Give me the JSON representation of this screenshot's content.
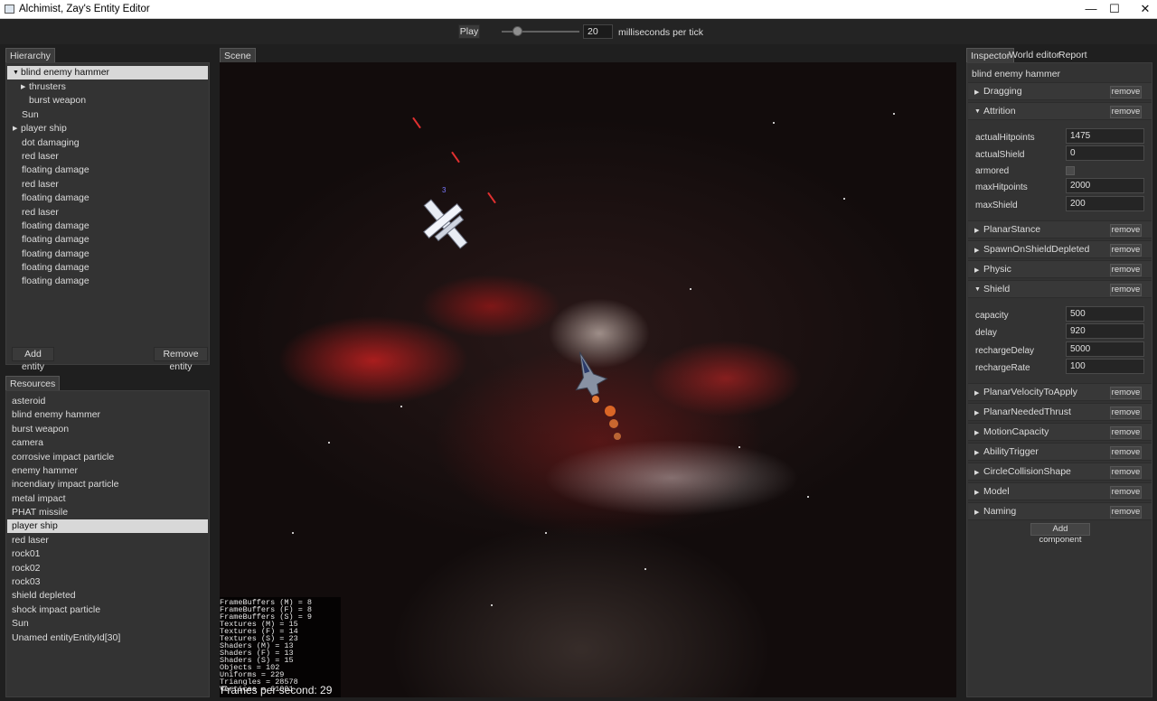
{
  "window": {
    "title": "Alchimist, Zay's Entity Editor"
  },
  "toolbar": {
    "play_label": "Play",
    "tick_value": "20",
    "tick_label": "milliseconds per tick"
  },
  "tabs": {
    "hierarchy": "Hierarchy",
    "scene": "Scene",
    "resources": "Resources",
    "inspector": "Inspector",
    "world_editor": "World editor",
    "report": "Report"
  },
  "hierarchy": {
    "items": [
      {
        "label": "blind enemy hammer",
        "arrow": "▼"
      },
      {
        "label": "thrusters",
        "arrow": "▶"
      },
      {
        "label": "burst weapon"
      },
      {
        "label": "Sun"
      },
      {
        "label": "player ship",
        "arrow": "▶"
      },
      {
        "label": "dot damaging"
      },
      {
        "label": "red laser"
      },
      {
        "label": "floating damage"
      },
      {
        "label": "red laser"
      },
      {
        "label": "floating damage"
      },
      {
        "label": "red laser"
      },
      {
        "label": "floating damage"
      },
      {
        "label": "floating damage"
      },
      {
        "label": "floating damage"
      },
      {
        "label": "floating damage"
      },
      {
        "label": "floating damage"
      }
    ],
    "add_label": "Add entity",
    "remove_label": "Remove entity"
  },
  "resources": {
    "items": [
      "asteroid",
      "blind enemy hammer",
      "burst weapon",
      "camera",
      "corrosive impact particle",
      "enemy hammer",
      "incendiary impact particle",
      "metal impact",
      "PHAT missile",
      "player ship",
      "red laser",
      "rock01",
      "rock02",
      "rock03",
      "shield depleted",
      "shock impact particle",
      "Sun",
      "Unamed entityEntityId[30]"
    ]
  },
  "scene": {
    "ship_label": "3",
    "debug_lines": [
      "FrameBuffers (M) = 8",
      "FrameBuffers (F) = 8",
      "FrameBuffers (S) = 9",
      "Textures (M) = 15",
      "Textures (F) = 14",
      "Textures (S) = 23",
      "Shaders (M) = 13",
      "Shaders (F) = 13",
      "Shaders (S) = 15",
      "Objects = 102",
      "Uniforms = 229",
      "Triangles = 28578",
      "Vertices = 61001"
    ],
    "fps_text": "Frames per second: 29"
  },
  "inspector": {
    "entity_name": "blind enemy hammer",
    "remove_label": "remove",
    "add_component_label": "Add component",
    "components": {
      "dragging": "Dragging",
      "attrition": {
        "name": "Attrition",
        "actualHitpoints_label": "actualHitpoints",
        "actualHitpoints_value": "1475",
        "actualShield_label": "actualShield",
        "actualShield_value": "0",
        "armored_label": "armored",
        "maxHitpoints_label": "maxHitpoints",
        "maxHitpoints_value": "2000",
        "maxShield_label": "maxShield",
        "maxShield_value": "200"
      },
      "planarStance": "PlanarStance",
      "spawnOnShieldDepleted": "SpawnOnShieldDepleted",
      "physic": "Physic",
      "shield": {
        "name": "Shield",
        "capacity_label": "capacity",
        "capacity_value": "500",
        "delay_label": "delay",
        "delay_value": "920",
        "rechargeDelay_label": "rechargeDelay",
        "rechargeDelay_value": "5000",
        "rechargeRate_label": "rechargeRate",
        "rechargeRate_value": "100"
      },
      "planarVelocityToApply": "PlanarVelocityToApply",
      "planarNeededThrust": "PlanarNeededThrust",
      "motionCapacity": "MotionCapacity",
      "abilityTrigger": "AbilityTrigger",
      "circleCollisionShape": "CircleCollisionShape",
      "model": "Model",
      "naming": "Naming"
    }
  },
  "icons": {
    "collapsed": "▶",
    "expanded": "▼"
  },
  "colors": {
    "panel": "#333333",
    "selection": "#d8d8d8",
    "background": "#1f1f1f"
  }
}
